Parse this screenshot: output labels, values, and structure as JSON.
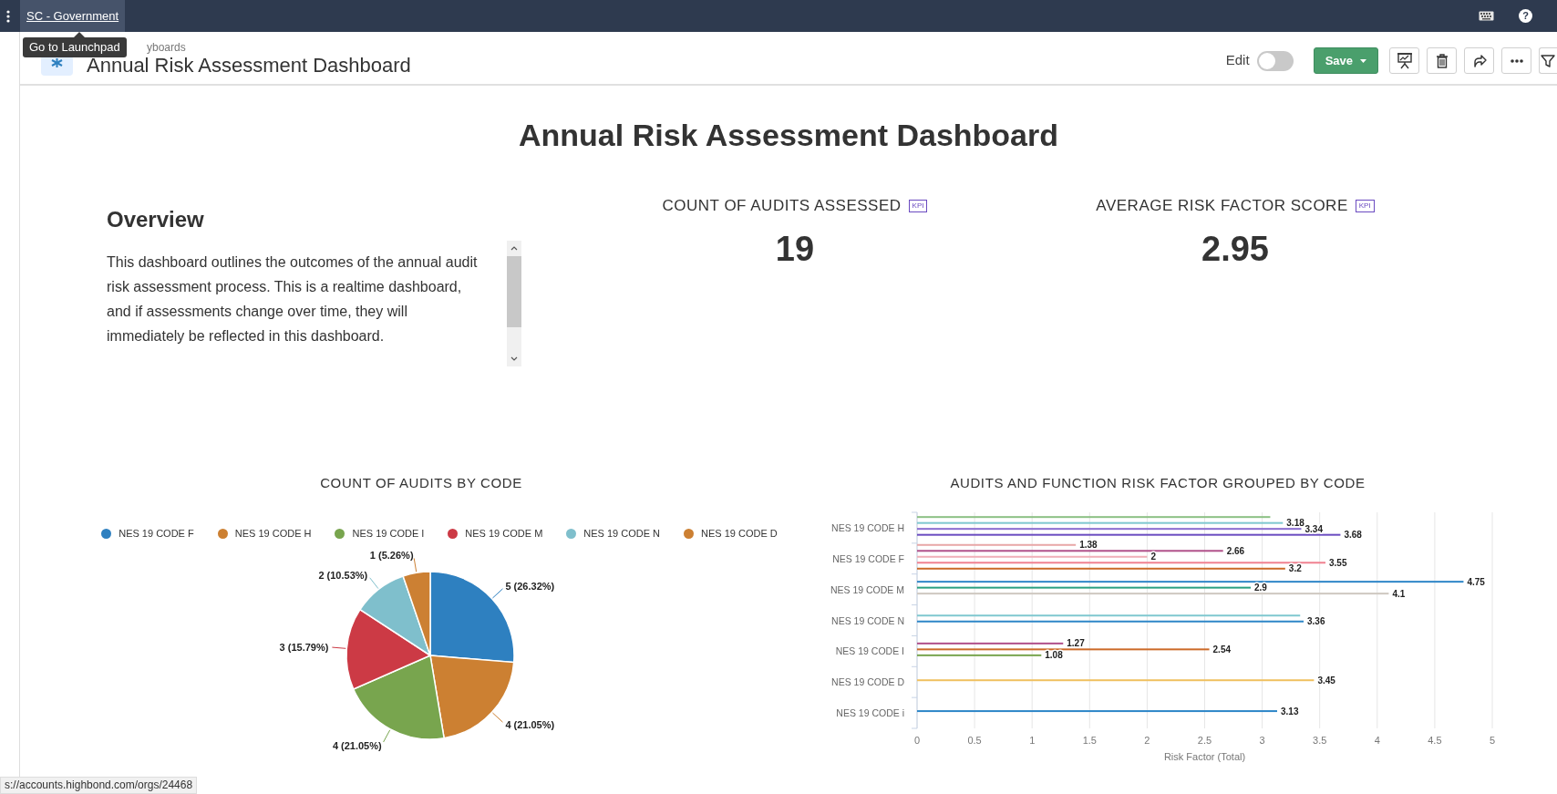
{
  "top_bar": {
    "org_link": "SC - Government",
    "tooltip": "Go to Launchpad",
    "help_glyph": "?"
  },
  "header": {
    "breadcrumb": "yboards",
    "title": "Annual Risk Assessment Dashboard",
    "edit_label": "Edit",
    "edit_on": false,
    "save_button": "Save"
  },
  "dashboard": {
    "title": "Annual Risk Assessment Dashboard",
    "overview": {
      "heading": "Overview",
      "text": "This dashboard outlines the outcomes of the annual audit risk assessment process. This is a realtime dashboard, and if assessments change over time, they will immediately be reflected in this dashboard."
    },
    "kpis": [
      {
        "label": "COUNT OF AUDITS ASSESSED",
        "badge": "KPI",
        "value": "19"
      },
      {
        "label": "AVERAGE RISK FACTOR SCORE",
        "badge": "KPI",
        "value": "2.95"
      }
    ],
    "pie_chart": {
      "title": "COUNT OF AUDITS BY CODE",
      "legend": [
        {
          "color": "#2e80c0"
        },
        {
          "color": "#cc8032"
        },
        {
          "color": "#78a54e"
        },
        {
          "color": "#cc3a45"
        },
        {
          "color": "#7fbfcc"
        },
        {
          "color": "#cc8033"
        }
      ],
      "chart_data": {
        "type": "pie",
        "categories": [
          "NES 19 CODE F",
          "NES 19 CODE H",
          "NES 19 CODE I",
          "NES 19 CODE M",
          "NES 19 CODE N",
          "NES 19 CODE D"
        ],
        "values": [
          26.32,
          21.05,
          21.05,
          15.79,
          10.53,
          5.26
        ],
        "value_labels": [
          "5 (26.32%)",
          "4 (21.05%)",
          "4 (21.05%)",
          "3 (15.79%)",
          "2 (10.53%)",
          "1 (5.26%)"
        ]
      }
    },
    "bar_chart": {
      "title": "AUDITS AND FUNCTION RISK FACTOR GROUPED BY CODE",
      "chart_data": {
        "type": "bar",
        "orientation": "horizontal",
        "xlabel": "Risk Factor (Total)",
        "grid": true,
        "categories": [
          "NES 19 CODE H",
          "NES 19 CODE F",
          "NES 19 CODE M",
          "NES 19 CODE N",
          "NES 19 CODE I",
          "NES 19 CODE D",
          "NES 19 CODE i"
        ],
        "xlim": [
          0,
          5
        ],
        "xticks": [
          0,
          0.5,
          1,
          1.5,
          2,
          2.5,
          3,
          3.5,
          4,
          4.5,
          5
        ],
        "series": [
          {
            "color": "#8cc084",
            "values": [
              3.07,
              null,
              null,
              null,
              null,
              null,
              null
            ],
            "value_labels": [
              null,
              null,
              null,
              null,
              null,
              null,
              null
            ]
          },
          {
            "color": "#7fc8d0",
            "values": [
              3.18,
              null,
              null,
              3.33,
              null,
              null,
              null
            ],
            "value_labels": [
              "3.18",
              null,
              null,
              null,
              null,
              null,
              null
            ]
          },
          {
            "color": "#8a6cd0",
            "values": [
              3.34,
              null,
              null,
              null,
              null,
              null,
              null
            ],
            "value_labels": [
              "3.34",
              null,
              null,
              null,
              null,
              null,
              null
            ]
          },
          {
            "color": "#6a4cc0",
            "values": [
              3.68,
              null,
              null,
              null,
              null,
              null,
              null
            ],
            "value_labels": [
              "3.68",
              null,
              null,
              null,
              null,
              null,
              null
            ]
          },
          {
            "color": "#e8a8a8",
            "values": [
              null,
              1.38,
              null,
              null,
              null,
              null,
              null
            ],
            "value_labels": [
              null,
              "1.38",
              null,
              null,
              null,
              null,
              null
            ]
          },
          {
            "color": "#b0508a",
            "values": [
              null,
              2.66,
              null,
              null,
              1.27,
              null,
              null
            ],
            "value_labels": [
              null,
              "2.66",
              null,
              null,
              "1.27",
              null,
              null
            ]
          },
          {
            "color": "#f0b0b8",
            "values": [
              null,
              2,
              null,
              null,
              null,
              null,
              null
            ],
            "value_labels": [
              null,
              "2",
              null,
              null,
              null,
              null,
              null
            ]
          },
          {
            "color": "#f08090",
            "values": [
              null,
              3.55,
              null,
              null,
              null,
              null,
              null
            ],
            "value_labels": [
              null,
              "3.55",
              null,
              null,
              null,
              null,
              null
            ]
          },
          {
            "color": "#cc6a28",
            "values": [
              null,
              3.2,
              null,
              null,
              2.54,
              null,
              null
            ],
            "value_labels": [
              null,
              "3.2",
              null,
              null,
              "2.54",
              null,
              null
            ]
          },
          {
            "color": "#2e86c8",
            "values": [
              null,
              null,
              4.75,
              3.36,
              null,
              null,
              3.13
            ],
            "value_labels": [
              null,
              null,
              "4.75",
              "3.36",
              null,
              null,
              "3.13"
            ]
          },
          {
            "color": "#2aa080",
            "values": [
              null,
              null,
              2.9,
              null,
              null,
              null,
              null
            ],
            "value_labels": [
              null,
              null,
              "2.9",
              null,
              null,
              null,
              null
            ]
          },
          {
            "color": "#cfc8c0",
            "values": [
              null,
              null,
              4.1,
              null,
              null,
              null,
              null
            ],
            "value_labels": [
              null,
              null,
              "4.1",
              null,
              null,
              null,
              null
            ]
          },
          {
            "color": "#78a54e",
            "values": [
              null,
              null,
              null,
              null,
              1.08,
              null,
              null
            ],
            "value_labels": [
              null,
              null,
              null,
              null,
              "1.08",
              null,
              null
            ]
          },
          {
            "color": "#f0c060",
            "values": [
              null,
              null,
              null,
              null,
              null,
              3.45,
              null
            ],
            "value_labels": [
              null,
              null,
              null,
              null,
              null,
              "3.45",
              null
            ]
          }
        ]
      }
    }
  },
  "status_url": "s://accounts.highbond.com/orgs/24468"
}
